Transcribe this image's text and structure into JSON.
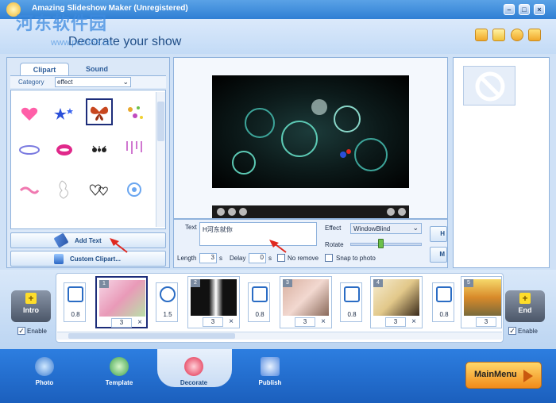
{
  "app": {
    "title": "Amazing Slideshow Maker (Unregistered)"
  },
  "header": {
    "heading": "Decorate your show",
    "watermark": "河东软件园",
    "watermark_url": "www.pc0359.cn"
  },
  "window_buttons": {
    "minimize": "–",
    "maximize": "□",
    "close": "×"
  },
  "left_panel": {
    "tabs": [
      "Clipart",
      "Sound"
    ],
    "category_label": "Category",
    "category_value": "effect",
    "add_text_label": "Add Text",
    "custom_clipart_label": "Custom Clipart..."
  },
  "text_panel": {
    "text_label": "Text",
    "text_value": "H河东就你",
    "effect_label": "Effect",
    "effect_value": "WindowBlind",
    "rotate_label": "Rotate",
    "length_label": "Length",
    "length_value": "3",
    "length_unit": "s",
    "delay_label": "Delay",
    "delay_value": "0",
    "delay_unit": "s",
    "no_remove_label": "No remove",
    "snap_label": "Snap to photo",
    "side_btn_top": "H",
    "side_btn_bottom": "M"
  },
  "timeline": {
    "intro_label": "Intro",
    "end_label": "End",
    "enable_label": "Enable",
    "slides": [
      {
        "num": "1",
        "dur": "3"
      },
      {
        "num": "2",
        "dur": "3"
      },
      {
        "num": "3",
        "dur": "3"
      },
      {
        "num": "4",
        "dur": "3"
      },
      {
        "num": "5",
        "dur": "3"
      }
    ],
    "transitions": [
      "0.8",
      "1.5",
      "0.8",
      "0.8",
      "0.8"
    ]
  },
  "nav": {
    "photo": "Photo",
    "template": "Template",
    "decorate": "Decorate",
    "publish": "Publish",
    "main_menu": "MainMenu"
  },
  "colors": {
    "accent": "#2f7fd4",
    "arrow": "#e0281f"
  }
}
